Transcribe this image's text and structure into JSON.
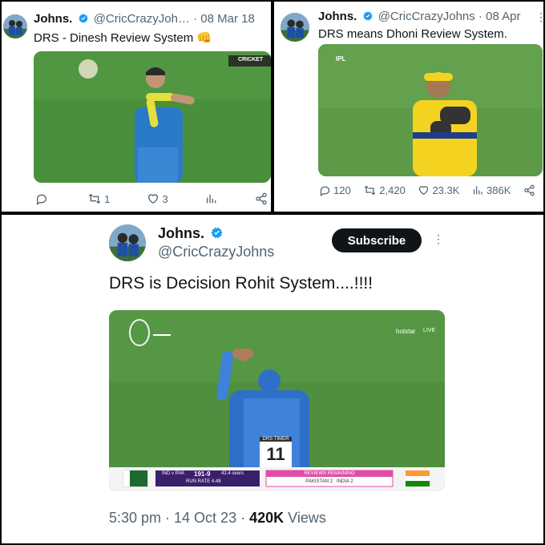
{
  "tweet_a": {
    "name": "Johns.",
    "handle": "@CricCrazyJoh…",
    "separator": "·",
    "date": "08 Mar 18",
    "text": "DRS - Dinesh Review System 👊",
    "media_overlay": "CRICKET",
    "actions": {
      "replies": "",
      "retweets": "1",
      "likes": "3"
    }
  },
  "tweet_b": {
    "name": "Johns.",
    "handle": "@CricCrazyJohns",
    "separator": "·",
    "date": "08 Apr",
    "text": "DRS means Dhoni Review System.",
    "media_overlay": "IPL",
    "actions": {
      "replies": "120",
      "retweets": "2,420",
      "likes": "23.3K",
      "views": "386K"
    }
  },
  "tweet_c": {
    "name": "Johns.",
    "handle": "@CricCrazyJohns",
    "subscribe_label": "Subscribe",
    "text": "DRS is Decision Rohit System....!!!!",
    "scoreboard": {
      "match": "IND v PAK",
      "score": "191-9",
      "overs": "42.4 overs",
      "run_rate": "RUN RATE 4.48",
      "reviews_label": "REVIEWS REMAINING",
      "reviews_detail": "PAKISTAN 2   INDIA 2",
      "drs_timer_label": "DRS TIMER",
      "drs_timer_value": "11",
      "broadcaster": "hotstar",
      "live_label": "LIVE"
    },
    "timestamp": "5:30 pm · 14 Oct 23 ·",
    "views_count": "420K",
    "views_label": "Views"
  },
  "colors": {
    "verified": "#1d9bf0",
    "pitch": "#4f8f3f",
    "india_blue": "#2f6fc9",
    "csk_yellow": "#f3d320"
  }
}
